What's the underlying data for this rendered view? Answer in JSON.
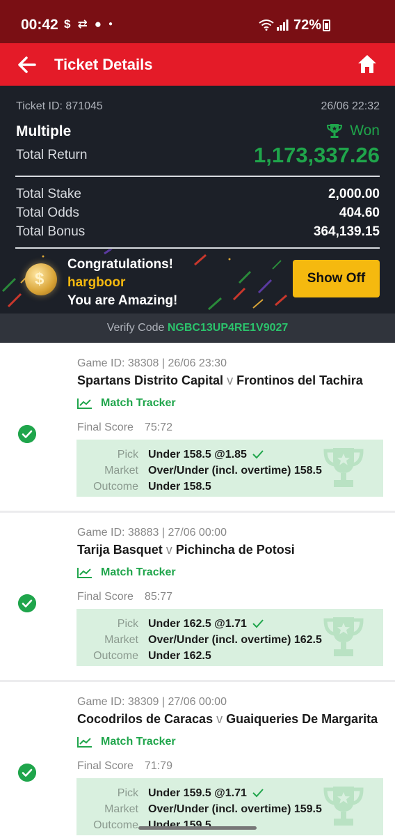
{
  "status": {
    "time": "00:42",
    "battery": "72%"
  },
  "header": {
    "title": "Ticket Details"
  },
  "ticket": {
    "id_text": "Ticket ID: 871045",
    "date": "26/06 22:32",
    "type": "Multiple",
    "result": "Won",
    "total_return_label": "Total Return",
    "total_return_value": "1,173,337.26",
    "rows": [
      {
        "label": "Total Stake",
        "value": "2,000.00"
      },
      {
        "label": "Total Odds",
        "value": "404.60"
      },
      {
        "label": "Total Bonus",
        "value": "364,139.15"
      }
    ],
    "congrats": {
      "line1": "Congratulations!",
      "username": "hargboor",
      "line3": "You are Amazing!",
      "button": "Show Off"
    },
    "verify": {
      "label": "Verify Code",
      "code": "NGBC13UP4RE1V9027"
    }
  },
  "games": [
    {
      "meta": "Game ID: 38308 | 26/06 23:30",
      "home": "Spartans Distrito Capital",
      "away": "Frontinos del Tachira",
      "tracker": "Match Tracker",
      "final_label": "Final Score",
      "score": "75:72",
      "pick": "Under 158.5 @1.85",
      "market": "Over/Under (incl. overtime) 158.5",
      "outcome": "Under 158.5"
    },
    {
      "meta": "Game ID: 38883 | 27/06 00:00",
      "home": "Tarija Basquet",
      "away": "Pichincha de Potosi",
      "tracker": "Match Tracker",
      "final_label": "Final Score",
      "score": "85:77",
      "pick": "Under 162.5 @1.71",
      "market": "Over/Under (incl. overtime) 162.5",
      "outcome": "Under 162.5"
    },
    {
      "meta": "Game ID: 38309 | 27/06 00:00",
      "home": "Cocodrilos de Caracas",
      "away": "Guaiqueries De Margarita",
      "tracker": "Match Tracker",
      "final_label": "Final Score",
      "score": "71:79",
      "pick": "Under 159.5 @1.71",
      "market": "Over/Under (incl. overtime) 159.5",
      "outcome": "Under 159.5"
    }
  ],
  "labels": {
    "pick": "Pick",
    "market": "Market",
    "outcome": "Outcome",
    "vs": "v"
  },
  "colors": {
    "header_red": "#e41b28",
    "status_red": "#7a0f14",
    "win_green": "#1fa54b",
    "gold": "#f5b90f",
    "summary_bg": "#1c2028"
  }
}
